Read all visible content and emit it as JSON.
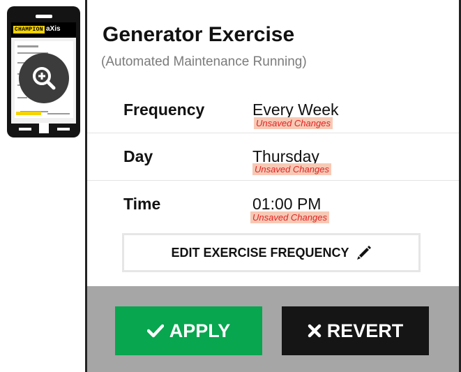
{
  "thumbnail": {
    "brand_champion": "CHAMPION",
    "brand_axis": "aXis"
  },
  "header": {
    "title": "Generator Exercise",
    "subtitle": "(Automated Maintenance Running)"
  },
  "settings": [
    {
      "label": "Frequency",
      "value": "Every Week",
      "status": "Unsaved Changes"
    },
    {
      "label": "Day",
      "value": "Thursday",
      "status": "Unsaved Changes"
    },
    {
      "label": "Time",
      "value": "01:00 PM",
      "status": "Unsaved Changes"
    }
  ],
  "edit_button": {
    "label": "EDIT EXERCISE FREQUENCY",
    "icon": "pencil-icon"
  },
  "footer": {
    "apply_label": "APPLY",
    "apply_icon": "checkmark-icon",
    "revert_label": "REVERT",
    "revert_icon": "x-icon"
  },
  "colors": {
    "apply": "#07a64f",
    "revert": "#151515",
    "unsaved_text": "#e02424",
    "unsaved_bg": "#f7c9b5",
    "footer_bg": "#a6a6a6"
  }
}
